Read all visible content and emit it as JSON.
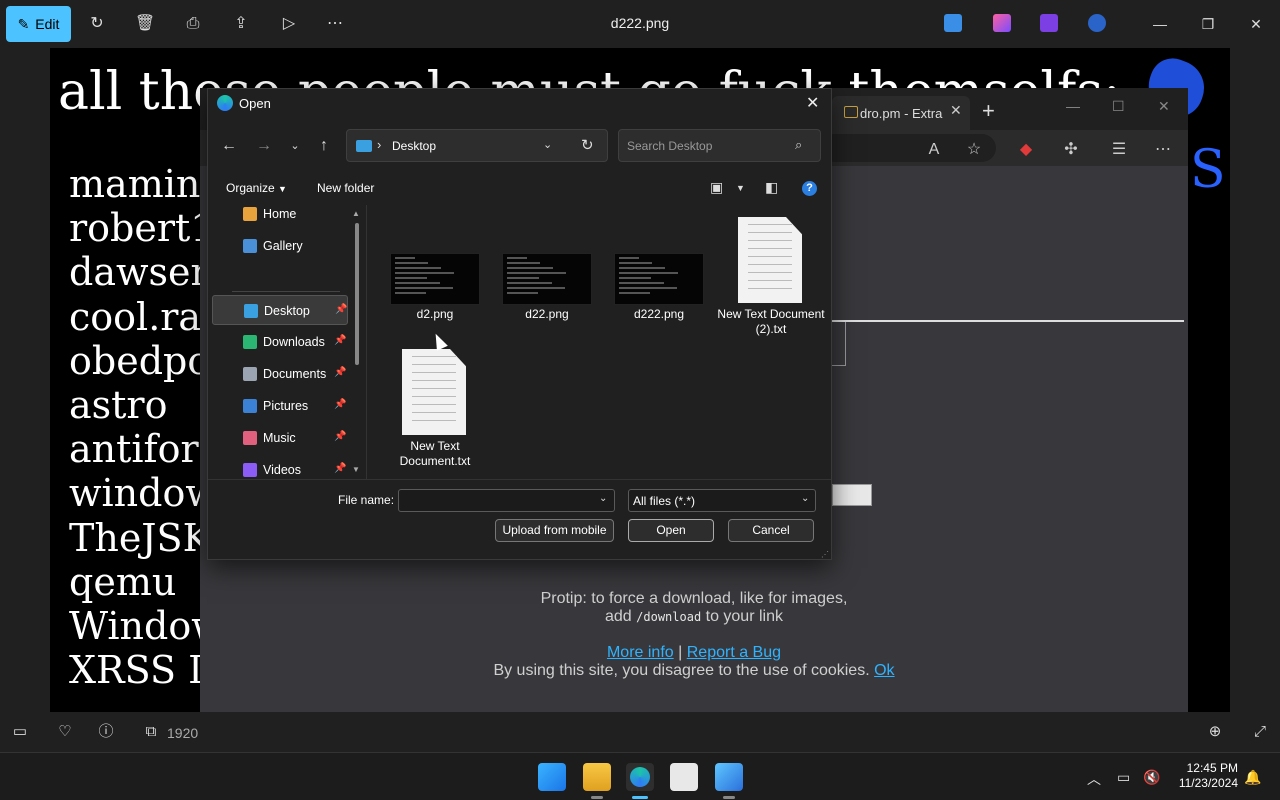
{
  "viewer": {
    "edit_label": "Edit",
    "file_title": "d222.png",
    "image_heading": "all these people must go fuck themselfs:",
    "image_names": [
      "maming",
      "robert1",
      "dawsen",
      "cool.ra",
      "obedpo",
      "astro",
      "antifor",
      "window",
      "TheJSK",
      "qemu",
      "Window",
      "XRSS I"
    ],
    "dimensions_text": "1920"
  },
  "browser": {
    "tab_title": "dro.pm - Extra",
    "protip_line1": "Protip: to force a download, like for images,",
    "protip_add": "add ",
    "protip_code": "/download",
    "protip_tail": " to your link",
    "more_info": "More info",
    "separator": "|",
    "report_bug": "Report a Bug",
    "cookie_text": "By using this site, you disagree to the use of cookies.",
    "ok_link": "Ok"
  },
  "dialog": {
    "title": "Open",
    "location": "Desktop",
    "search_placeholder": "Search Desktop",
    "organize_label": "Organize",
    "new_folder_label": "New folder",
    "sidebar": [
      {
        "label": "Home",
        "color": "#e8a33d",
        "pinned": false
      },
      {
        "label": "Gallery",
        "color": "#4a90d9",
        "pinned": false
      },
      {
        "label": "Desktop",
        "color": "#3aa0e0",
        "pinned": true
      },
      {
        "label": "Downloads",
        "color": "#2bb673",
        "pinned": true
      },
      {
        "label": "Documents",
        "color": "#9aa4b2",
        "pinned": true
      },
      {
        "label": "Pictures",
        "color": "#3b82d6",
        "pinned": true
      },
      {
        "label": "Music",
        "color": "#e0607e",
        "pinned": true
      },
      {
        "label": "Videos",
        "color": "#8b5cf6",
        "pinned": true
      }
    ],
    "files": [
      {
        "name": "d2.png",
        "kind": "image"
      },
      {
        "name": "d22.png",
        "kind": "image"
      },
      {
        "name": "d222.png",
        "kind": "image"
      },
      {
        "name": "New Text Document (2).txt",
        "kind": "text"
      },
      {
        "name": "New Text Document.txt",
        "kind": "text"
      }
    ],
    "file_name_label": "File name:",
    "file_name_value": "",
    "file_type": "All files (*.*)",
    "upload_label": "Upload from mobile",
    "open_label": "Open",
    "cancel_label": "Cancel"
  },
  "taskbar": {
    "time": "12:45 PM",
    "date": "11/23/2024"
  }
}
